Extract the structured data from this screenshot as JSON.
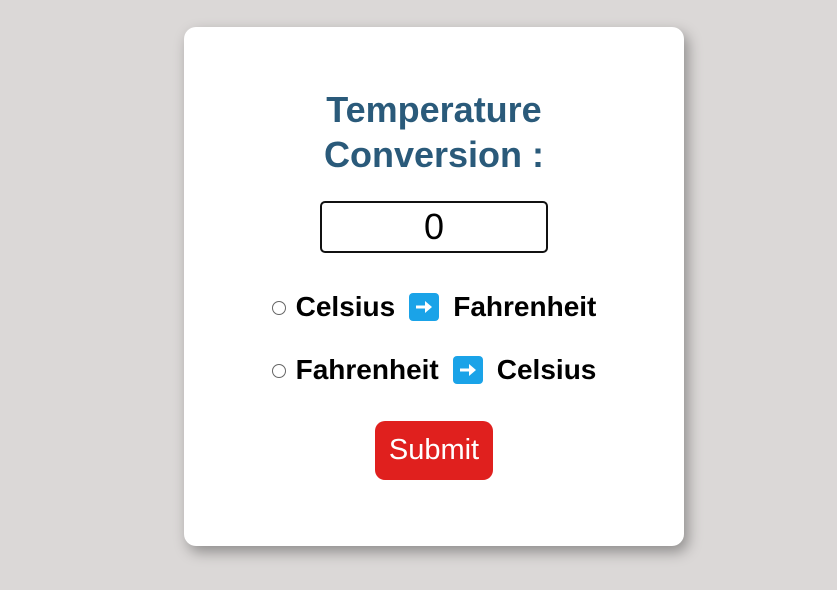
{
  "card": {
    "title_line1": "Temperature",
    "title_line2": "Conversion :",
    "input": {
      "value": "0"
    },
    "options": [
      {
        "from": "Celsius",
        "to": "Fahrenheit",
        "arrow_icon": "right-arrow-icon"
      },
      {
        "from": "Fahrenheit",
        "to": "Celsius",
        "arrow_icon": "right-arrow-icon"
      }
    ],
    "submit_label": "Submit"
  },
  "colors": {
    "background": "#dbd8d7",
    "title": "#2a5a7a",
    "arrow": "#1aa3e8",
    "submit": "#e0201e"
  }
}
